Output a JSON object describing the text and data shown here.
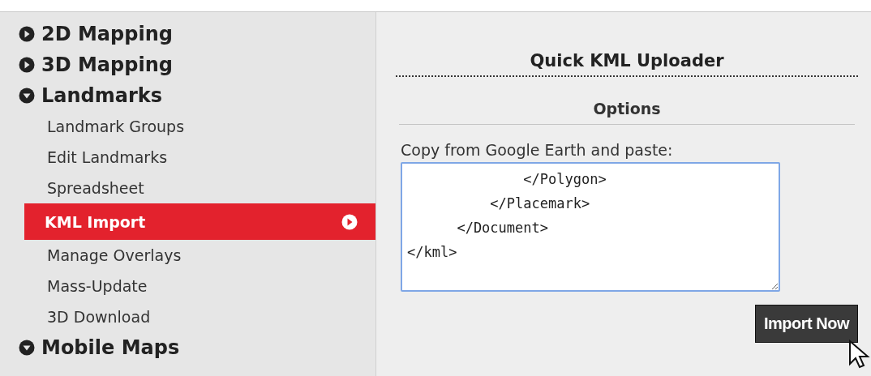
{
  "sidebar": {
    "sections": [
      {
        "label": "2D Mapping",
        "expanded": false
      },
      {
        "label": "3D Mapping",
        "expanded": false
      },
      {
        "label": "Landmarks",
        "expanded": true,
        "children": [
          {
            "label": "Landmark Groups",
            "selected": false
          },
          {
            "label": "Edit Landmarks",
            "selected": false
          },
          {
            "label": "Spreadsheet",
            "selected": false
          },
          {
            "label": "KML Import",
            "selected": true
          },
          {
            "label": "Manage Overlays",
            "selected": false
          },
          {
            "label": "Mass-Update",
            "selected": false
          },
          {
            "label": "3D Download",
            "selected": false
          }
        ]
      },
      {
        "label": "Mobile Maps",
        "expanded": true
      }
    ]
  },
  "uploader": {
    "title": "Quick KML Uploader",
    "section": "Options",
    "field_label": "Copy from Google Earth and paste:",
    "value": "              </Polygon>\n          </Placemark>\n      </Document>\n</kml>",
    "button": "Import Now"
  }
}
